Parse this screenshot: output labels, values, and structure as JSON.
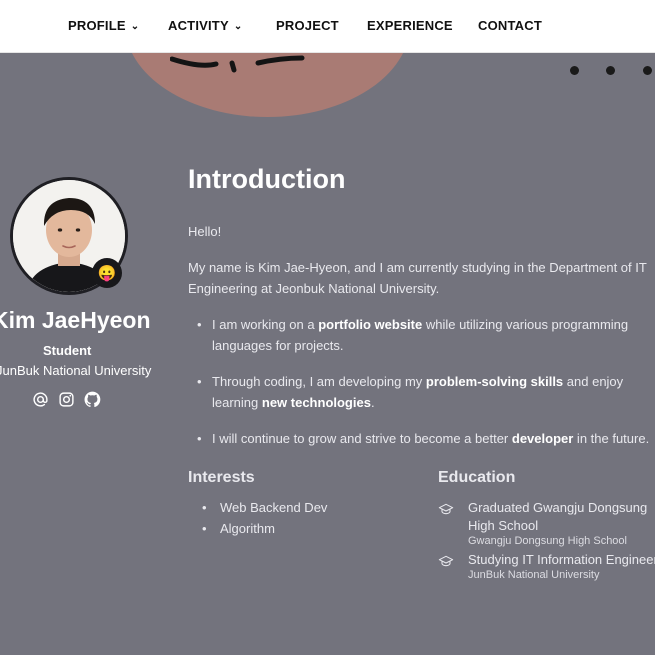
{
  "nav": {
    "items": [
      {
        "label": "PROFILE",
        "has_menu": true
      },
      {
        "label": "ACTIVITY",
        "has_menu": true
      },
      {
        "label": "PROJECT",
        "has_menu": false
      },
      {
        "label": "EXPERIENCE",
        "has_menu": false
      },
      {
        "label": "CONTACT",
        "has_menu": false
      }
    ],
    "chevron": "⌄"
  },
  "profile": {
    "name": "Kim JaeHyeon",
    "role": "Student",
    "school": "JunBuk National University",
    "status_emoji": "😛",
    "socials": [
      "email-icon",
      "instagram-icon",
      "github-icon"
    ]
  },
  "intro": {
    "title": "Introduction",
    "greeting": "Hello!",
    "about": "My name is Kim Jae-Hyeon, and I am currently studying in the Department of IT Engineering at Jeonbuk National University.",
    "bullets": [
      {
        "pre": "I am working on a ",
        "bold": "portfolio website",
        "post": " while utilizing various programming languages for projects.",
        "bold2": "",
        "post2": ""
      },
      {
        "pre": "Through coding, I am developing my ",
        "bold": "problem-solving skills",
        "post": " and enjoy learning ",
        "bold2": "new technologies",
        "post2": "."
      },
      {
        "pre": "I will continue to grow and strive to become a better ",
        "bold": "developer",
        "post": " in the future.",
        "bold2": "",
        "post2": ""
      }
    ]
  },
  "interests": {
    "title": "Interests",
    "items": [
      "Web Backend Dev",
      "Algorithm"
    ]
  },
  "education": {
    "title": "Education",
    "items": [
      {
        "title": "Graduated Gwangju Dongsung High School",
        "sub": "Gwangju Dongsung High School"
      },
      {
        "title": "Studying IT Information Engineering",
        "sub": "JunBuk National University"
      }
    ]
  },
  "colors": {
    "background": "#73737d",
    "nav_bg": "#ffffff",
    "decor": "#a97b74"
  }
}
